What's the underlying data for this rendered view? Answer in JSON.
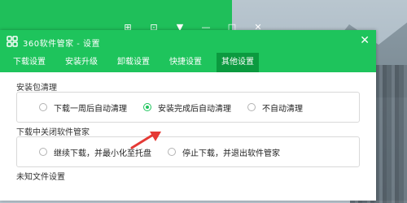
{
  "back_window": {
    "controls": [
      "⊞",
      "⊡",
      "▼",
      "—",
      "□",
      "✕"
    ]
  },
  "window": {
    "title": "360软件管家 - 设置",
    "close": "✕",
    "tabs": [
      {
        "label": "下载设置",
        "active": false
      },
      {
        "label": "安装升级",
        "active": false
      },
      {
        "label": "卸载设置",
        "active": false
      },
      {
        "label": "快捷设置",
        "active": false
      },
      {
        "label": "其他设置",
        "active": true
      }
    ]
  },
  "groups": [
    {
      "title": "安装包清理",
      "options": [
        {
          "label": "下载一周后自动清理",
          "selected": false
        },
        {
          "label": "安装完成后自动清理",
          "selected": true
        },
        {
          "label": "不自动清理",
          "selected": false
        }
      ]
    },
    {
      "title": "下载中关闭软件管家",
      "options": [
        {
          "label": "继续下载，并最小化至托盘",
          "selected": false
        },
        {
          "label": "停止下载，并退出软件管家",
          "selected": false
        }
      ]
    },
    {
      "title": "未知文件设置",
      "options": []
    }
  ],
  "colors": {
    "accent": "#1ec45c",
    "active_tab": "#0b9a3f",
    "arrow": "#e53935"
  }
}
